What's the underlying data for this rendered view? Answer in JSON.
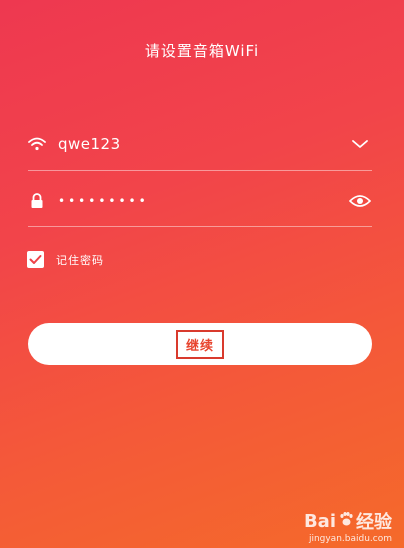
{
  "header": {
    "title": "请设置音箱WiFi"
  },
  "form": {
    "ssid_value": "qwe123",
    "password_masked": "•••••••••",
    "remember_label": "记住密码",
    "remember_checked": true
  },
  "actions": {
    "continue_label": "继续"
  },
  "watermark": {
    "brand_left": "Bai",
    "brand_right": "经验",
    "url": "jingyan.baidu.com"
  },
  "colors": {
    "gradient_top": "#ee3850",
    "gradient_bottom": "#f56a2a",
    "button_text": "#e8452f",
    "highlight_box": "#d93a2d"
  },
  "icons": {
    "ssid_lead": "wifi-icon",
    "ssid_trail": "chevron-down-icon",
    "pwd_lead": "lock-icon",
    "pwd_trail": "eye-icon",
    "checkbox": "checkmark-icon",
    "watermark_logo": "paw-icon"
  }
}
